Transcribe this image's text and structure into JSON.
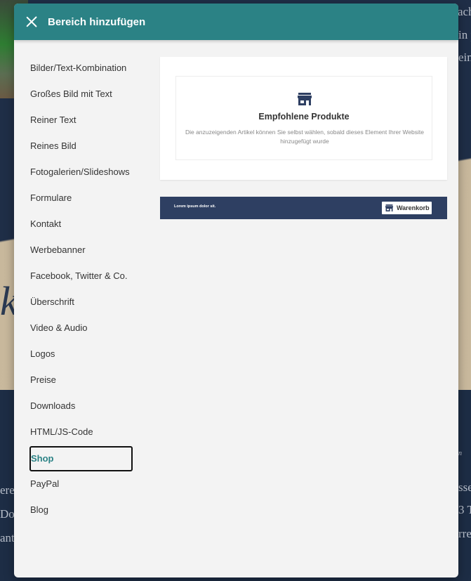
{
  "modal": {
    "title": "Bereich hinzufügen",
    "close_icon": "close-icon"
  },
  "sidebar": {
    "items": [
      {
        "label": "Bilder/Text-Kombination",
        "active": false
      },
      {
        "label": "Großes Bild mit Text",
        "active": false
      },
      {
        "label": "Reiner Text",
        "active": false
      },
      {
        "label": "Reines Bild",
        "active": false
      },
      {
        "label": "Fotogalerien/Slideshows",
        "active": false
      },
      {
        "label": "Formulare",
        "active": false
      },
      {
        "label": "Kontakt",
        "active": false
      },
      {
        "label": "Werbebanner",
        "active": false
      },
      {
        "label": "Facebook, Twitter & Co.",
        "active": false
      },
      {
        "label": "Überschrift",
        "active": false
      },
      {
        "label": "Video & Audio",
        "active": false
      },
      {
        "label": "Logos",
        "active": false
      },
      {
        "label": "Preise",
        "active": false
      },
      {
        "label": "Downloads",
        "active": false
      },
      {
        "label": "HTML/JS-Code",
        "active": false
      },
      {
        "label": "Shop",
        "active": true
      },
      {
        "label": "PayPal",
        "active": false
      },
      {
        "label": "Blog",
        "active": false
      }
    ]
  },
  "preview": {
    "featured": {
      "icon": "store-icon",
      "title": "Empfohlene Produkte",
      "description": "Die anzuzeigenden Artikel können Sie selbst wählen, sobald dieses Element Ihrer Website hinzugefügt wurde"
    },
    "shop_bar": {
      "text": "Lorem ipsum dolor sit.",
      "cart_icon": "store-icon",
      "cart_label": "Warenkorb"
    }
  },
  "background": {
    "right_fragments": [
      "ach",
      "in p",
      "ein"
    ],
    "right_lower_fragments": [
      "sse",
      "3 T",
      "rre"
    ],
    "left_lower_fragments": [
      "ere",
      "Do",
      "ant"
    ],
    "script_text": "ki",
    "small_right": "n"
  },
  "colors": {
    "header": "#2b8285",
    "active_item": "#2b8285",
    "shop_bar": "#2e3f62",
    "store_icon": "#2e3f62"
  }
}
